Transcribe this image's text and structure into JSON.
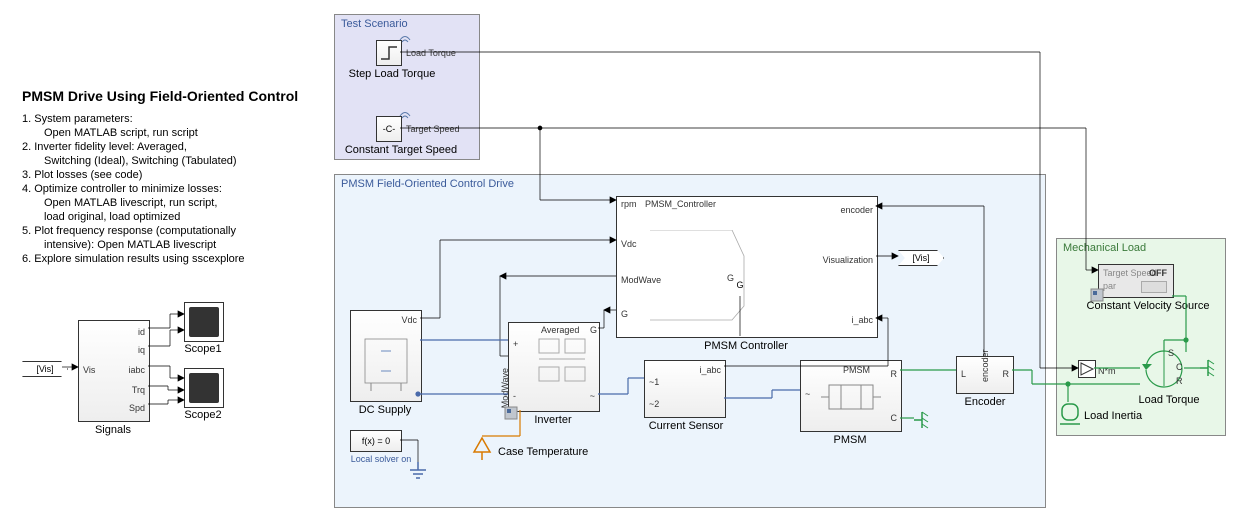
{
  "title": "PMSM Drive Using Field-Oriented Control",
  "notes": {
    "l1": "1. System parameters:",
    "l1a": "Open MATLAB script, run script",
    "l2": "2. Inverter fidelity level: Averaged,",
    "l2a": "Switching (Ideal), Switching (Tabulated)",
    "l3": "3. Plot losses (see code)",
    "l4": "4. Optimize controller to minimize losses:",
    "l4a": "Open MATLAB livescript, run script,",
    "l4b": "load original, load optimized",
    "l5": "5. Plot frequency response (computationally",
    "l5a": "intensive): Open MATLAB livescript",
    "l6": "6. Explore simulation results using sscexplore"
  },
  "left": {
    "vis_tag": "[Vis]",
    "signals_block": "Signals",
    "signals_ports": {
      "vis": "Vis",
      "id": "id",
      "iq": "iq",
      "iabc": "iabc",
      "trq": "Trq",
      "spd": "Spd"
    },
    "scope1": "Scope1",
    "scope2": "Scope2"
  },
  "test_scenario": {
    "title": "Test Scenario",
    "step_label": "Step Load Torque",
    "step_out": "Load Torque",
    "const_label": "Constant Target Speed",
    "const_val": "-C-",
    "const_out": "Target Speed"
  },
  "drive": {
    "title": "PMSM Field-Oriented Control Drive",
    "dc_supply": "DC Supply",
    "dc_port": "Vdc",
    "fx0": "f(x) = 0",
    "local_solver": "Local solver on",
    "inverter": "Inverter",
    "inv_modwave": "ModWave",
    "inv_avg": "Averaged",
    "inv_plus": "+",
    "inv_minus": "-",
    "inv_tilde": "~",
    "inv_g": "G",
    "case_temp": "Case Temperature",
    "current_sensor": "Current Sensor",
    "cs_iabc": "i_abc",
    "cs_1": "~1",
    "cs_2": "~2",
    "controller_block": "PMSM_Controller",
    "controller_label": "PMSM Controller",
    "ctrl_rpm": "rpm",
    "ctrl_vdc": "Vdc",
    "ctrl_modwave": "ModWave",
    "ctrl_g": "G",
    "ctrl_encoder": "encoder",
    "ctrl_viz": "Visualization",
    "ctrl_iabc": "i_abc",
    "ctrl_gport": "G",
    "vis_tag": "[Vis]",
    "pmsm": "PMSM",
    "pmsm_r": "R",
    "pmsm_c": "C",
    "pmsm_tilde": "~",
    "encoder": "Encoder",
    "enc_l": "L",
    "enc_r": "R",
    "enc_port": "encoder"
  },
  "mech": {
    "title": "Mechanical Load",
    "cvs": "Constant Velocity Source",
    "cvs_off": "OFF",
    "cvs_target": "Target Speed",
    "cvs_par": "par",
    "load_torque": "Load Torque",
    "lt_nm": "N*m",
    "lt_s": "S",
    "lt_c": "C",
    "lt_r": "R",
    "load_inertia": "Load Inertia"
  }
}
